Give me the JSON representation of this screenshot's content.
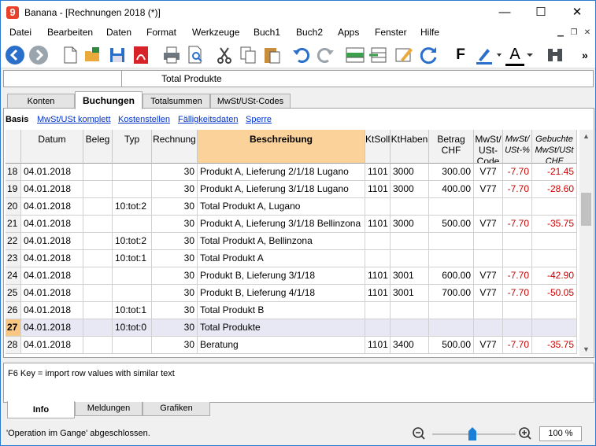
{
  "window": {
    "app_logo": "9",
    "title": "Banana - [Rechnungen 2018 (*)]",
    "minimize": "—",
    "maximize": "☐",
    "close": "✕"
  },
  "menu": [
    "Datei",
    "Bearbeiten",
    "Daten",
    "Format",
    "Werkzeuge",
    "Buch1",
    "Buch2",
    "Apps",
    "Fenster",
    "Hilfe"
  ],
  "toolbar": {
    "icons": [
      "back-icon",
      "forward-icon",
      "new-file-icon",
      "open-folder-icon",
      "save-icon",
      "pdf-icon",
      "print-icon",
      "print-preview-icon",
      "cut-icon",
      "copy-icon",
      "paste-icon",
      "undo-icon",
      "redo-icon",
      "add-row-icon",
      "insert-row-icon",
      "edit-icon",
      "refresh-icon",
      "bold-icon",
      "highlight-icon",
      "font-color-icon",
      "binoculars-icon"
    ],
    "bold_label": "F",
    "font_color_label": "A",
    "more_label": "»"
  },
  "formula_bar": {
    "cell_ref": "",
    "value": "Total Produkte"
  },
  "tabs": [
    "Konten",
    "Buchungen",
    "Totalsummen",
    "MwSt/USt-Codes"
  ],
  "active_tab": "Buchungen",
  "views": [
    "Basis",
    "MwSt/USt komplett",
    "Kostenstellen",
    "Fälligkeitsdaten",
    "Sperre"
  ],
  "columns": [
    "Datum",
    "Beleg",
    "Typ",
    "Rechnung",
    "Beschreibung",
    "KtSoll",
    "KtHaben",
    "Betrag CHF",
    "MwSt/ USt-Code",
    "MwSt/ USt-%",
    "Gebuchte MwSt/USt CHF"
  ],
  "rows": [
    {
      "num": "18",
      "datum": "04.01.2018",
      "beleg": "",
      "typ": "",
      "rechnung": "30",
      "beschreibung": "Produkt A, Lieferung 2/1/18 Lugano",
      "ktsoll": "1101",
      "kthaben": "3000",
      "betrag": "300.00",
      "code": "V77",
      "pct": "-7.70",
      "gebucht": "-21.45"
    },
    {
      "num": "19",
      "datum": "04.01.2018",
      "beleg": "",
      "typ": "",
      "rechnung": "30",
      "beschreibung": "Produkt A, Lieferung 3/1/18 Lugano",
      "ktsoll": "1101",
      "kthaben": "3000",
      "betrag": "400.00",
      "code": "V77",
      "pct": "-7.70",
      "gebucht": "-28.60"
    },
    {
      "num": "20",
      "datum": "04.01.2018",
      "beleg": "",
      "typ": "10:tot:2",
      "rechnung": "30",
      "beschreibung": "Total Produkt A, Lugano",
      "ktsoll": "",
      "kthaben": "",
      "betrag": "",
      "code": "",
      "pct": "",
      "gebucht": ""
    },
    {
      "num": "21",
      "datum": "04.01.2018",
      "beleg": "",
      "typ": "",
      "rechnung": "30",
      "beschreibung": "Produkt A, Lieferung 3/1/18 Bellinzona",
      "ktsoll": "1101",
      "kthaben": "3000",
      "betrag": "500.00",
      "code": "V77",
      "pct": "-7.70",
      "gebucht": "-35.75"
    },
    {
      "num": "22",
      "datum": "04.01.2018",
      "beleg": "",
      "typ": "10:tot:2",
      "rechnung": "30",
      "beschreibung": "Total Produkt A, Bellinzona",
      "ktsoll": "",
      "kthaben": "",
      "betrag": "",
      "code": "",
      "pct": "",
      "gebucht": ""
    },
    {
      "num": "23",
      "datum": "04.01.2018",
      "beleg": "",
      "typ": "10:tot:1",
      "rechnung": "30",
      "beschreibung": "Total Produkt A",
      "ktsoll": "",
      "kthaben": "",
      "betrag": "",
      "code": "",
      "pct": "",
      "gebucht": ""
    },
    {
      "num": "24",
      "datum": "04.01.2018",
      "beleg": "",
      "typ": "",
      "rechnung": "30",
      "beschreibung": "Produkt B, Lieferung 3/1/18",
      "ktsoll": "1101",
      "kthaben": "3001",
      "betrag": "600.00",
      "code": "V77",
      "pct": "-7.70",
      "gebucht": "-42.90"
    },
    {
      "num": "25",
      "datum": "04.01.2018",
      "beleg": "",
      "typ": "",
      "rechnung": "30",
      "beschreibung": "Produkt B, Lieferung 4/1/18",
      "ktsoll": "1101",
      "kthaben": "3001",
      "betrag": "700.00",
      "code": "V77",
      "pct": "-7.70",
      "gebucht": "-50.05"
    },
    {
      "num": "26",
      "datum": "04.01.2018",
      "beleg": "",
      "typ": "10:tot:1",
      "rechnung": "30",
      "beschreibung": "Total Produkt B",
      "ktsoll": "",
      "kthaben": "",
      "betrag": "",
      "code": "",
      "pct": "",
      "gebucht": ""
    },
    {
      "num": "27",
      "datum": "04.01.2018",
      "beleg": "",
      "typ": "10:tot:0",
      "rechnung": "30",
      "beschreibung": "Total Produkte",
      "ktsoll": "",
      "kthaben": "",
      "betrag": "",
      "code": "",
      "pct": "",
      "gebucht": ""
    },
    {
      "num": "28",
      "datum": "04.01.2018",
      "beleg": "",
      "typ": "",
      "rechnung": "30",
      "beschreibung": "Beratung",
      "ktsoll": "1101",
      "kthaben": "3400",
      "betrag": "500.00",
      "code": "V77",
      "pct": "-7.70",
      "gebucht": "-35.75"
    }
  ],
  "current_row": "27",
  "info_text": "F6 Key = import row values with similar text",
  "bottom_tabs": [
    "Info",
    "Meldungen",
    "Grafiken"
  ],
  "status_text": "'Operation im Gange' abgeschlossen.",
  "zoom": "100 %",
  "colors": {
    "accent": "#f9c783",
    "negative": "#cc0000",
    "link": "#0033cc"
  }
}
